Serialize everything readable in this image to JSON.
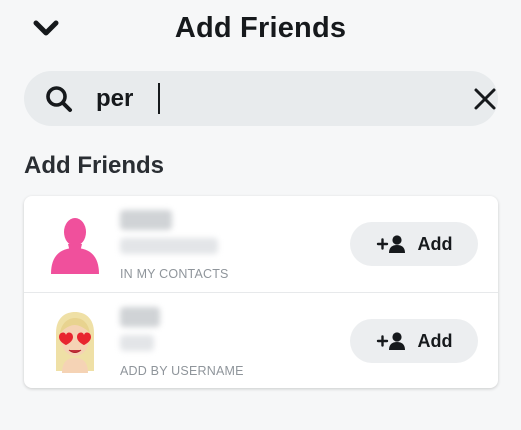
{
  "header": {
    "title": "Add Friends",
    "back_icon": "chevron-down-icon"
  },
  "search": {
    "value": "per",
    "placeholder": "",
    "search_icon": "search-icon",
    "clear_icon": "close-icon"
  },
  "section": {
    "title": "Add Friends"
  },
  "results": [
    {
      "meta": "IN MY CONTACTS",
      "avatar": "pink-silhouette-avatar",
      "add_label": "Add",
      "add_icon": "add-friend-icon"
    },
    {
      "meta": "ADD BY USERNAME",
      "avatar": "bitmoji-heart-eyes-avatar",
      "add_label": "Add",
      "add_icon": "add-friend-icon"
    }
  ],
  "colors": {
    "background": "#f6f7f8",
    "search_bar": "#e8ebed",
    "card": "#ffffff",
    "button": "#eceef0",
    "text": "#16191c",
    "meta_text": "#8f959b",
    "avatar_pink": "#f0509c"
  }
}
